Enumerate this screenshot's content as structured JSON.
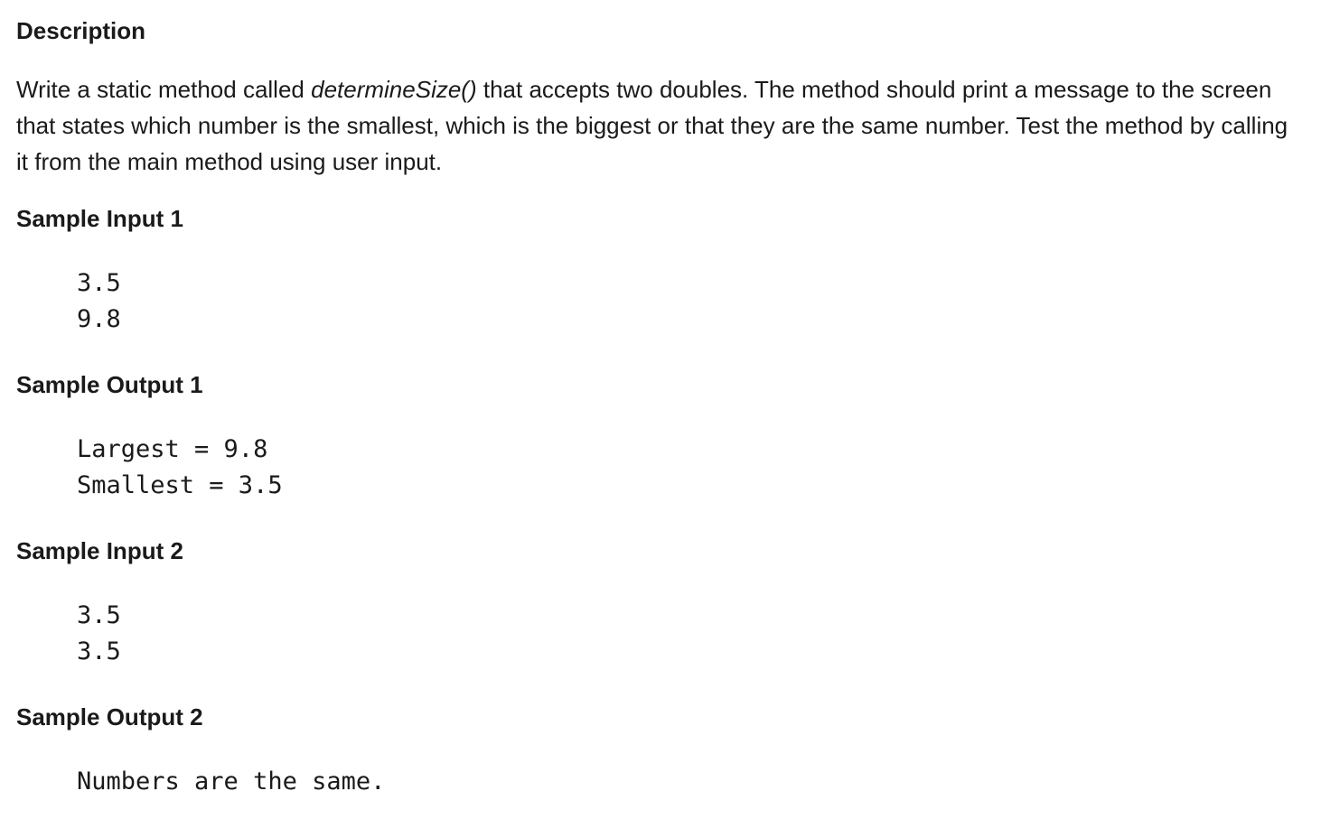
{
  "description": {
    "heading": "Description",
    "text_before": "Write a static method called ",
    "method_name": "determineSize()",
    "text_after": " that accepts two doubles. The method should print a message to the screen that states which number is the smallest, which is the biggest or that they are the same number. Test the method by calling it from the main method using user input."
  },
  "samples": [
    {
      "heading": "Sample Input 1",
      "lines": [
        "3.5",
        "9.8"
      ]
    },
    {
      "heading": "Sample Output 1",
      "lines": [
        "Largest = 9.8",
        "Smallest = 3.5"
      ]
    },
    {
      "heading": "Sample Input 2",
      "lines": [
        "3.5",
        "3.5"
      ]
    },
    {
      "heading": "Sample Output 2",
      "lines": [
        "Numbers are the same."
      ]
    }
  ]
}
